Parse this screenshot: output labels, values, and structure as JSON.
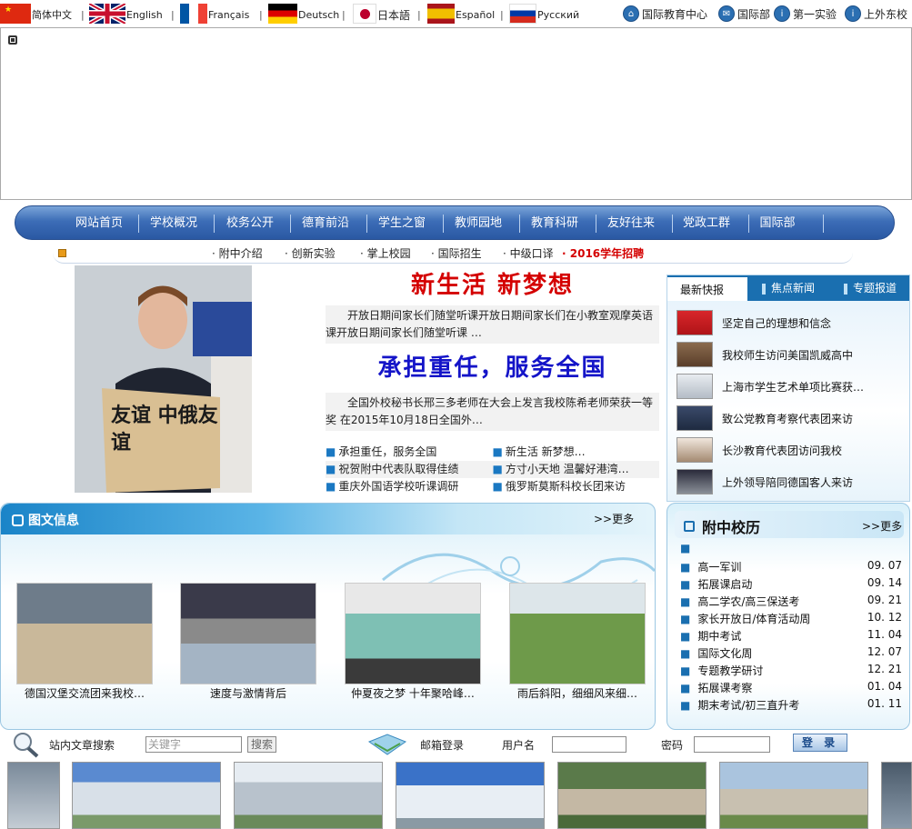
{
  "languages": [
    {
      "label": "简体中文",
      "flag": "cn-flag"
    },
    {
      "label": "English",
      "flag": "uk-flag"
    },
    {
      "label": "Français",
      "flag": "fr-flag"
    },
    {
      "label": "Deutsch",
      "flag": "de-flag"
    },
    {
      "label": "日本語",
      "flag": "jp-flag"
    },
    {
      "label": "Español",
      "flag": "es-flag"
    },
    {
      "label": "Русский",
      "flag": "ru-flag"
    }
  ],
  "separator": "|",
  "top_links": [
    {
      "label": "国际教育中心",
      "icon": "home-icon"
    },
    {
      "label": "国际部",
      "icon": "mail-icon"
    },
    {
      "label": "第一实验",
      "icon": "info-icon"
    },
    {
      "label": "上外东校",
      "icon": "info-icon"
    }
  ],
  "nav": [
    "网站首页",
    "学校概况",
    "校务公开",
    "德育前沿",
    "学生之窗",
    "教师园地",
    "教育科研",
    "友好往来",
    "党政工群",
    "国际部"
  ],
  "subnav": [
    "附中介绍",
    "创新实验",
    "掌上校园",
    "国际招生",
    "中级口译",
    "2016学年招聘"
  ],
  "feature": {
    "headline1": "新生活  新梦想",
    "para1": "开放日期间家长们随堂听课开放日期间家长们在小教室观摩英语课开放日期间家长们随堂听课    …",
    "headline2": "承担重任，服务全国",
    "para2": "全国外校秘书长邢三多老师在大会上发言我校陈希老师荣获一等奖        在2015年10月18日全国外…",
    "photo_sign": "友谊 中俄友谊",
    "links": [
      [
        "承担重任，服务全国",
        "新生活  新梦想…"
      ],
      [
        "祝贺附中代表队取得佳绩",
        "方寸小天地 温馨好港湾…"
      ],
      [
        "重庆外国语学校听课调研",
        "俄罗斯莫斯科校长团来访"
      ]
    ]
  },
  "right_news": {
    "tabs": [
      "最新快报",
      "焦点新闻",
      "专题报道"
    ],
    "items": [
      "坚定自己的理想和信念",
      "我校师生访问美国凯威高中",
      "上海市学生艺术单项比赛获…",
      "致公党教育考察代表团来访",
      "长沙教育代表团访问我校",
      "上外领导陪同德国客人来访"
    ]
  },
  "gallery": {
    "title": "图文信息",
    "more": ">>更多",
    "items": [
      "德国汉堡交流团来我校…",
      "速度与激情背后",
      "仲夏夜之梦 十年聚哈峰…",
      "雨后斜阳，细细风来细…"
    ]
  },
  "history": {
    "title": "附中校历",
    "more": ">>更多",
    "rows": [
      {
        "event": "",
        "date": ""
      },
      {
        "event": "高一军训",
        "date": "09. 07"
      },
      {
        "event": "拓展课启动",
        "date": "09. 14"
      },
      {
        "event": "高二学农/高三保送考",
        "date": "09. 21"
      },
      {
        "event": "家长开放日/体育活动周",
        "date": "10. 12"
      },
      {
        "event": "期中考试",
        "date": "11. 04"
      },
      {
        "event": "国际文化周",
        "date": "12. 07"
      },
      {
        "event": "专题教学研讨",
        "date": "12. 21"
      },
      {
        "event": "拓展课考察",
        "date": "01. 04"
      },
      {
        "event": "期末考试/初三直升考",
        "date": "01. 11"
      }
    ]
  },
  "search": {
    "label": "站内文章搜索",
    "placeholder": "关键字",
    "button": "搜索"
  },
  "login": {
    "label": "邮箱登录",
    "user_label": "用户名",
    "pass_label": "密码",
    "button": "登 录"
  },
  "colors": {
    "nav": "#3c6db7",
    "accent": "#1a84c8",
    "red": "#d40000"
  }
}
